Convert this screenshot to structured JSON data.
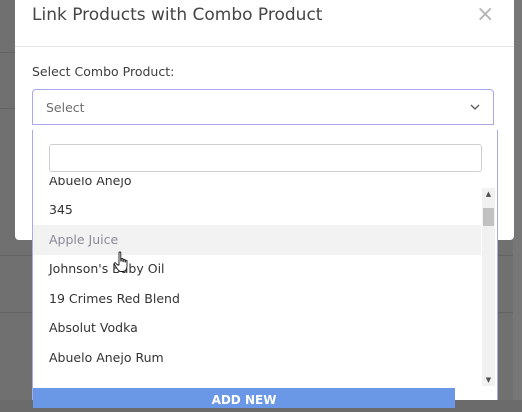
{
  "modal": {
    "title": "Link Products with Combo Product",
    "close_glyph": "×",
    "field_label": "Select Combo Product:",
    "select_value": "Select"
  },
  "dropdown": {
    "search_value": "",
    "items": [
      {
        "label": "Abuelo Anejo"
      },
      {
        "label": "345"
      },
      {
        "label": "Apple Juice",
        "hovered": true
      },
      {
        "label": "Johnson's Baby Oil"
      },
      {
        "label": "19 Crimes Red Blend"
      },
      {
        "label": "Absolut Vodka"
      },
      {
        "label": "Abuelo Anejo Rum"
      }
    ],
    "add_new_label": "ADD NEW"
  },
  "icons": {
    "close": "close-icon",
    "chevron": "chevron-down-icon",
    "cursor": "hand-pointer-icon"
  },
  "colors": {
    "accent_border": "#a9a8e8",
    "add_button": "#6a97e6"
  }
}
